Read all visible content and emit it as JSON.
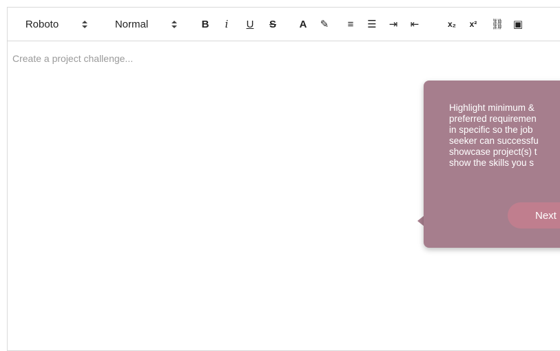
{
  "toolbar": {
    "font_select": "Roboto",
    "size_select": "Normal",
    "icons": {
      "bold": "B",
      "italic": "i",
      "underline": "U",
      "strike": "S",
      "text_color": "A",
      "highlight": "✎",
      "ordered_list": "≡",
      "bullet_list": "☰",
      "indent": "⇥",
      "outdent": "⇤",
      "subscript": "x₂",
      "superscript": "x²",
      "link": "⛓",
      "media": "▣"
    }
  },
  "editor": {
    "placeholder": "Create a project challenge..."
  },
  "tooltip": {
    "text": "Highlight minimum &\npreferred requiremen\nin specific so the job\nseeker can successfu\nshowcase project(s) t\nshow the skills you s",
    "next_label": "Next"
  },
  "colors": {
    "popover_bg": "#a67e8d",
    "next_btn": "#c07e8e"
  }
}
